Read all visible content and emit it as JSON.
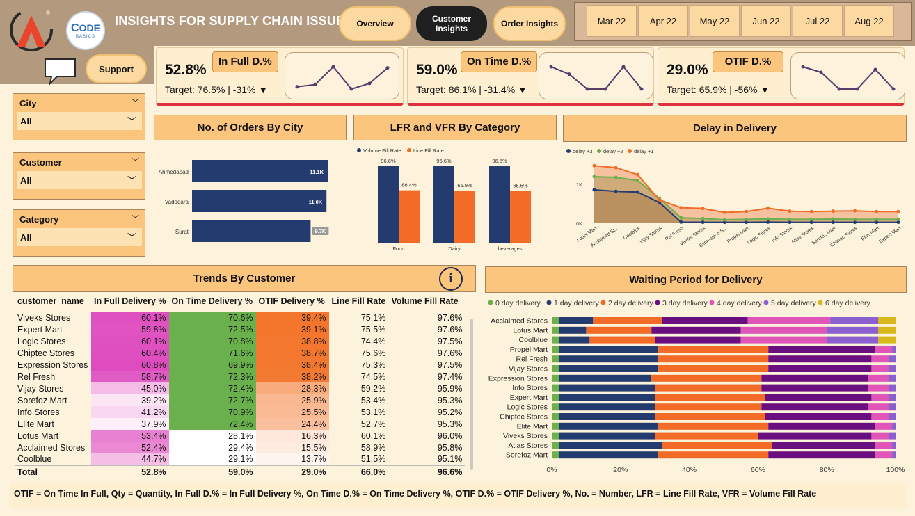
{
  "header": {
    "title": "INSIGHTS FOR SUPPLY CHAIN ISSUE",
    "logo_text": "ODE",
    "logo_sub": "BASICS",
    "nav": [
      {
        "label": "Overview",
        "active": false
      },
      {
        "label": "Customer Insights",
        "active": true
      },
      {
        "label": "Order Insights",
        "active": false
      }
    ],
    "months": [
      "Mar 22",
      "Apr 22",
      "May 22",
      "Jun 22",
      "Jul 22",
      "Aug 22"
    ],
    "support_label": "Support"
  },
  "kpis": [
    {
      "value": "52.8%",
      "label": "In Full D.%",
      "target": "Target: 76.5% | -31% ▼",
      "spark": [
        60,
        62,
        78,
        58,
        63,
        77
      ]
    },
    {
      "value": "59.0%",
      "label": "On Time D.%",
      "target": "Target: 86.1% | -31.4% ▼",
      "spark": [
        63,
        61,
        57,
        57,
        63,
        57
      ]
    },
    {
      "value": "29.0%",
      "label": "OTIF D.%",
      "target": "Target: 65.9% | -56% ▼",
      "spark": [
        38,
        36,
        30,
        30,
        37,
        30
      ]
    }
  ],
  "filters": [
    {
      "label": "City",
      "value": "All"
    },
    {
      "label": "Customer",
      "value": "All"
    },
    {
      "label": "Category",
      "value": "All"
    }
  ],
  "orders_by_city": {
    "title": "No. of Orders By City",
    "chart_data": {
      "type": "bar",
      "categories": [
        "Ahmedabad",
        "Vadodara",
        "Surat"
      ],
      "values": [
        11100,
        11000,
        9700
      ],
      "labels": [
        "11.1K",
        "11.0K",
        "9.7K"
      ]
    }
  },
  "lfr_vfr": {
    "title": "LFR and VFR By Category",
    "chart_data": {
      "type": "bar",
      "categories": [
        "Food",
        "Dairy",
        "beverages"
      ],
      "series": [
        {
          "name": "Volume Fill Rate",
          "values": [
            96.6,
            96.6,
            96.5
          ],
          "labels": [
            "96.6%",
            "96.6%",
            "96.5%"
          ],
          "color": "#233b6e"
        },
        {
          "name": "Line Fill Rate",
          "values": [
            66.4,
            65.9,
            65.5
          ],
          "labels": [
            "66.4%",
            "65.9%",
            "65.5%"
          ],
          "color": "#f26b27"
        }
      ]
    }
  },
  "delay": {
    "title": "Delay in Delivery",
    "chart_data": {
      "type": "area",
      "categories": [
        "Lotus Mart",
        "Acclaimed St...",
        "Coolblue",
        "Vijay Stores",
        "Rel Fresh",
        "Viveks Stores",
        "Expression S...",
        "Propel Mart",
        "Logic Stores",
        "Info Stores",
        "Atlas Stores",
        "Sorefoz Mart",
        "Chiptec Stores",
        "Elite Mart",
        "Expert Mart"
      ],
      "yticks": [
        "0K",
        "1K"
      ],
      "ylim": [
        0,
        1700
      ],
      "series": [
        {
          "name": "delay +3",
          "color": "#233b6e",
          "values": [
            860,
            820,
            800,
            530,
            30,
            25,
            25,
            25,
            30,
            25,
            25,
            25,
            25,
            25,
            25
          ]
        },
        {
          "name": "delay +2",
          "color": "#6ab04c",
          "values": [
            1200,
            1180,
            1100,
            640,
            140,
            120,
            90,
            100,
            110,
            100,
            100,
            110,
            100,
            100,
            100
          ]
        },
        {
          "name": "delay +1",
          "color": "#f26b27",
          "values": [
            1480,
            1430,
            1250,
            600,
            400,
            380,
            280,
            300,
            390,
            310,
            300,
            310,
            320,
            300,
            300
          ]
        }
      ]
    }
  },
  "trends": {
    "title": "Trends By Customer",
    "info_glyph": "i",
    "columns": [
      "customer_name",
      "In Full Delivery %",
      "On Time Delivery %",
      "OTIF Delivery %",
      "Line Fill Rate",
      "Volume Fill Rate"
    ],
    "rows": [
      [
        "Viveks Stores",
        "60.1%",
        "70.6%",
        "39.4%",
        "75.1%",
        "97.6%"
      ],
      [
        "Expert Mart",
        "59.8%",
        "72.5%",
        "39.1%",
        "75.5%",
        "97.6%"
      ],
      [
        "Logic Stores",
        "60.1%",
        "70.8%",
        "38.8%",
        "74.4%",
        "97.5%"
      ],
      [
        "Chiptec Stores",
        "60.4%",
        "71.6%",
        "38.7%",
        "75.6%",
        "97.6%"
      ],
      [
        "Expression Stores",
        "60.8%",
        "69.9%",
        "38.4%",
        "75.3%",
        "97.5%"
      ],
      [
        "Rel Fresh",
        "58.7%",
        "72.3%",
        "38.2%",
        "74.5%",
        "97.4%"
      ],
      [
        "Vijay Stores",
        "45.0%",
        "72.4%",
        "28.3%",
        "59.2%",
        "95.9%"
      ],
      [
        "Sorefoz Mart",
        "39.2%",
        "72.7%",
        "25.9%",
        "53.4%",
        "95.3%"
      ],
      [
        "Info Stores",
        "41.2%",
        "70.9%",
        "25.5%",
        "53.1%",
        "95.2%"
      ],
      [
        "Elite Mart",
        "37.9%",
        "72.4%",
        "24.4%",
        "52.7%",
        "95.3%"
      ],
      [
        "Lotus Mart",
        "53.4%",
        "28.1%",
        "16.3%",
        "60.1%",
        "96.0%"
      ],
      [
        "Acclaimed Stores",
        "52.4%",
        "29.4%",
        "15.5%",
        "58.9%",
        "95.8%"
      ],
      [
        "Coolblue",
        "44.7%",
        "29.1%",
        "13.7%",
        "51.5%",
        "95.1%"
      ]
    ],
    "total": [
      "Total",
      "52.8%",
      "59.0%",
      "29.0%",
      "66.0%",
      "96.6%"
    ]
  },
  "waiting": {
    "title": "Waiting Period for Delivery",
    "chart_data": {
      "type": "bar",
      "stacked_100": true,
      "legend": [
        "0 day delivery",
        "1 day delivery",
        "2 day delivery",
        "3 day delivery",
        "4 day delivery",
        "5 day delivery",
        "6 day delivery"
      ],
      "colors": [
        "#6ab04c",
        "#233b6e",
        "#f26b27",
        "#6a0f7f",
        "#e055b8",
        "#8a5fd0",
        "#d8b81d"
      ],
      "xticks": [
        "0%",
        "20%",
        "40%",
        "60%",
        "80%",
        "100%"
      ],
      "categories": [
        "Acclaimed Stores",
        "Lotus Mart",
        "Coolblue",
        "Propel Mart",
        "Rel Fresh",
        "Vijay Stores",
        "Expression Stores",
        "Info Stores",
        "Expert Mart",
        "Logic Stores",
        "Chiptec Stores",
        "Elite Mart",
        "Viveks Stores",
        "Atlas Stores",
        "Sorefoz Mart"
      ],
      "values": [
        [
          2,
          10,
          20,
          25,
          24,
          14,
          5
        ],
        [
          2,
          8,
          19,
          26,
          25,
          15,
          5
        ],
        [
          2,
          9,
          19,
          25,
          25,
          15,
          5
        ],
        [
          2,
          29,
          32,
          31,
          5,
          1,
          0
        ],
        [
          2,
          29,
          32,
          30,
          5,
          2,
          0
        ],
        [
          2,
          29,
          32,
          30,
          5,
          2,
          0
        ],
        [
          2,
          27,
          32,
          31,
          6,
          2,
          0
        ],
        [
          2,
          28,
          31,
          31,
          6,
          2,
          0
        ],
        [
          2,
          28,
          32,
          31,
          5,
          2,
          0
        ],
        [
          2,
          28,
          31,
          31,
          6,
          2,
          0
        ],
        [
          2,
          28,
          32,
          31,
          5,
          2,
          0
        ],
        [
          2,
          29,
          32,
          31,
          5,
          1,
          0
        ],
        [
          2,
          28,
          30,
          33,
          5,
          2,
          0
        ],
        [
          2,
          30,
          32,
          30,
          5,
          1,
          0
        ],
        [
          2,
          29,
          32,
          31,
          5,
          1,
          0
        ]
      ]
    }
  },
  "footer": {
    "note": "OTIF = On Time In Full, Qty = Quantity, In Full D.% = In Full Delivery %, On Time D.% = On Time Delivery %, OTIF D.% = OTIF Delivery %, No. = Number, LFR = Line Fill Rate, VFR = Volume Fill Rate"
  }
}
